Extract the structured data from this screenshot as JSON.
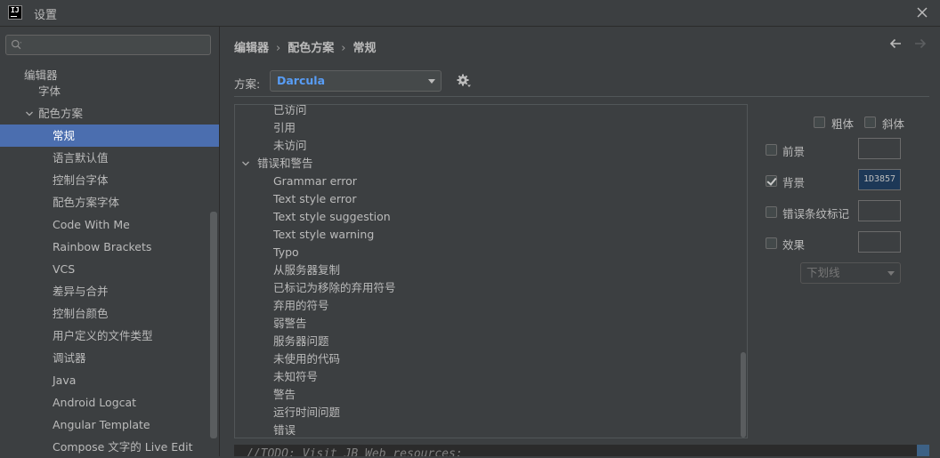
{
  "window": {
    "title": "设置",
    "app_icon_text": "IJ"
  },
  "search": {
    "placeholder": ""
  },
  "sidebar": {
    "items": [
      {
        "label": "编辑器",
        "level": 0
      },
      {
        "label": "字体",
        "level": 1
      },
      {
        "label": "配色方案",
        "level": 1,
        "expanded": true
      },
      {
        "label": "常规",
        "level": 2,
        "selected": true
      },
      {
        "label": "语言默认值",
        "level": 2
      },
      {
        "label": "控制台字体",
        "level": 2
      },
      {
        "label": "配色方案字体",
        "level": 2
      },
      {
        "label": "Code With Me",
        "level": 2
      },
      {
        "label": "Rainbow Brackets",
        "level": 2
      },
      {
        "label": "VCS",
        "level": 2
      },
      {
        "label": "差异与合并",
        "level": 2
      },
      {
        "label": "控制台颜色",
        "level": 2
      },
      {
        "label": "用户定义的文件类型",
        "level": 2
      },
      {
        "label": "调试器",
        "level": 2
      },
      {
        "label": "Java",
        "level": 2
      },
      {
        "label": "Android Logcat",
        "level": 2
      },
      {
        "label": "Angular Template",
        "level": 2
      },
      {
        "label": "Compose 文字的 Live Edit",
        "level": 2
      }
    ]
  },
  "breadcrumb": {
    "items": [
      "编辑器",
      "配色方案",
      "常规"
    ]
  },
  "scheme": {
    "label": "方案:",
    "value": "Darcula"
  },
  "attributes_list": {
    "items": [
      {
        "label": "已访问",
        "group": false
      },
      {
        "label": "引用",
        "group": false
      },
      {
        "label": "未访问",
        "group": false
      },
      {
        "label": "错误和警告",
        "group": true
      },
      {
        "label": "Grammar error",
        "group": false
      },
      {
        "label": "Text style error",
        "group": false
      },
      {
        "label": "Text style suggestion",
        "group": false
      },
      {
        "label": "Text style warning",
        "group": false
      },
      {
        "label": "Typo",
        "group": false
      },
      {
        "label": "从服务器复制",
        "group": false
      },
      {
        "label": "已标记为移除的弃用符号",
        "group": false
      },
      {
        "label": "弃用的符号",
        "group": false
      },
      {
        "label": "弱警告",
        "group": false
      },
      {
        "label": "服务器问题",
        "group": false
      },
      {
        "label": "未使用的代码",
        "group": false
      },
      {
        "label": "未知符号",
        "group": false
      },
      {
        "label": "警告",
        "group": false
      },
      {
        "label": "运行时间问题",
        "group": false
      },
      {
        "label": "错误",
        "group": false
      }
    ]
  },
  "properties": {
    "bold": {
      "label": "粗体",
      "checked": false
    },
    "italic": {
      "label": "斜体",
      "checked": false
    },
    "foreground": {
      "label": "前景",
      "checked": false,
      "value": ""
    },
    "background": {
      "label": "背景",
      "checked": true,
      "value": "1D3857",
      "color": "#1D3857"
    },
    "error_stripe": {
      "label": "错误条纹标记",
      "checked": false,
      "value": ""
    },
    "effects": {
      "label": "效果",
      "checked": false,
      "value": "",
      "type": "下划线"
    }
  },
  "preview": {
    "text": "//TODO: Visit JB Web resources:"
  },
  "colors": {
    "selection": "#4B6EAF",
    "scheme_value": "#589DF6",
    "background_swatch": "#1D3857"
  }
}
